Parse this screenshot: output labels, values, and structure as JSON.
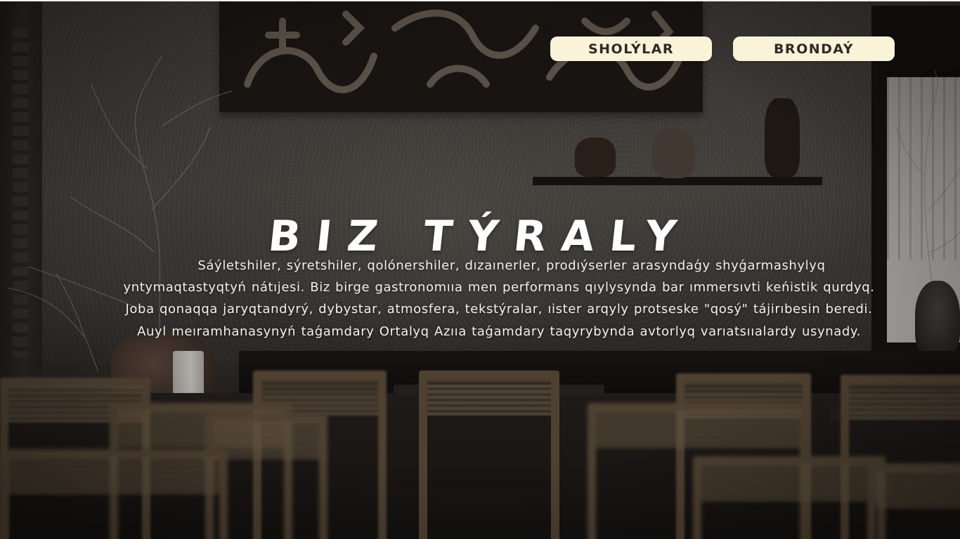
{
  "nav": {
    "menu_label": "SHOLÝLAR",
    "booking_label": "BRONDAÝ"
  },
  "about": {
    "title": "BIZ TÝRALY",
    "description": "Sáýletshiler, sýretshiler, qolónershiler, dızaınerler, prodıýserler arasyndaǵy shyǵarmashylyq yntymaqtastyqtyń nátıjesi. Biz birge gastronomııa men performans qıylysynda bar ımmersıvti keńistik qurdyq. Joba qonaqqa jaryqtandyrý, dybystar, atmosfera, tekstýralar, ıister arqyly protseske \"qosý\" tájirıbesin beredi. Auyl meıramhanasynyń taǵamdary Ortalyq Azııa taǵamdary taqyrybynda avtorlyq varıatsııalardy usynady."
  },
  "colors": {
    "button_bg": "#fbf3d8",
    "button_text": "#2f2a28",
    "heading_text": "#ffffff",
    "body_text": "#f3f1ee"
  }
}
